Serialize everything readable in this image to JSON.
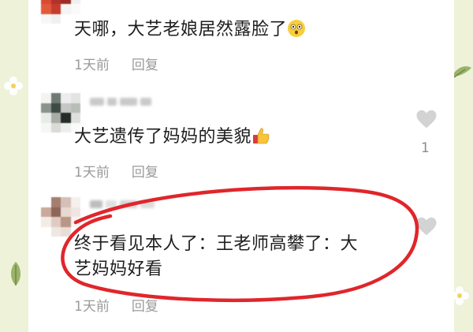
{
  "comments": [
    {
      "text": "天哪，大艺老娘居然露脸了",
      "emoji": "astonished-face-icon",
      "time": "1天前",
      "reply_label": "回复"
    },
    {
      "text": "大艺遗传了妈妈的美貌",
      "emoji": "thumbs-up-icon",
      "time": "1天前",
      "reply_label": "回复",
      "like_count": "1"
    },
    {
      "text_line1": "终于看见本人了：王老师高攀了：大",
      "text_line2": "艺妈妈好看",
      "time": "1天前",
      "reply_label": "回复"
    }
  ],
  "annotation": {
    "shape": "hand-drawn-circle",
    "color": "#e0262b"
  },
  "colors": {
    "text": "#1e1e1e",
    "meta": "#9a9a9a",
    "background": "#eef2d9",
    "heart": "#d3d3d3"
  }
}
